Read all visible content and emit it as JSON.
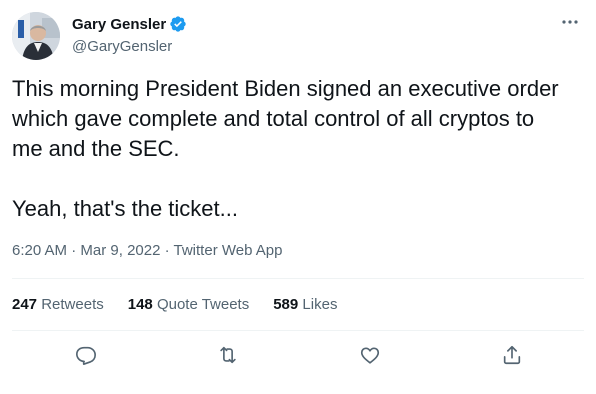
{
  "user": {
    "display_name": "Gary Gensler",
    "handle": "@GaryGensler",
    "verified": true
  },
  "tweet": {
    "lines": [
      "This morning President Biden signed an executive order",
      "which gave complete and total control of all cryptos to",
      "me and the SEC."
    ],
    "line2": "Yeah, that's the ticket...",
    "time": "6:20 AM",
    "separator": "·",
    "date": "Mar 9, 2022",
    "app": "Twitter Web App"
  },
  "stats": {
    "retweets": {
      "count": "247",
      "label": "Retweets"
    },
    "quotes": {
      "count": "148",
      "label": "Quote Tweets"
    },
    "likes": {
      "count": "589",
      "label": "Likes"
    }
  },
  "icons": {
    "more": "more-icon",
    "reply": "reply-icon",
    "retweet": "retweet-icon",
    "like": "like-icon",
    "share": "share-icon",
    "verified": "verified-badge-icon"
  },
  "colors": {
    "verified": "#1d9bf0",
    "secondary_text": "#536471",
    "primary_text": "#0f1419",
    "divider": "#eff3f4"
  }
}
